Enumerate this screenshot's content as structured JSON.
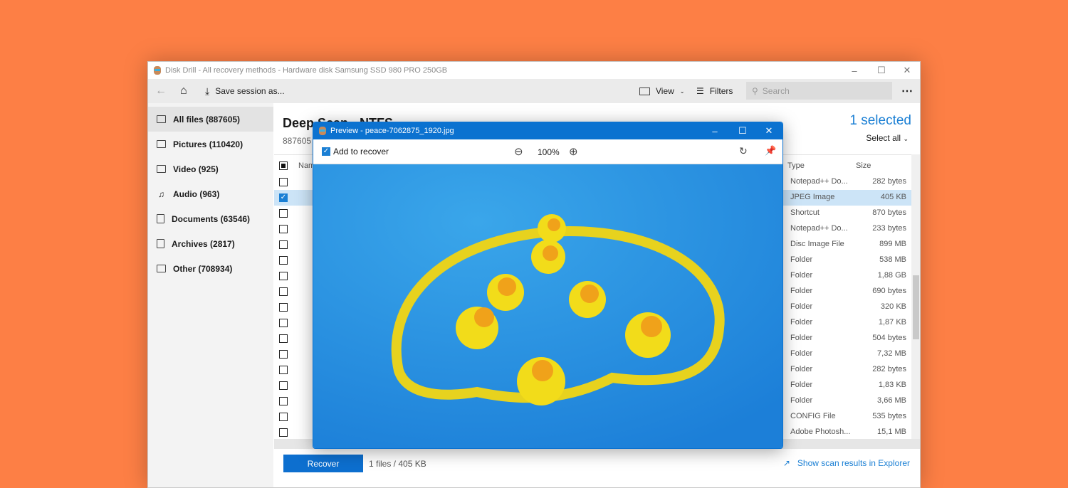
{
  "window": {
    "title": "Disk Drill - All recovery methods - Hardware disk Samsung SSD 980 PRO 250GB"
  },
  "toolbar": {
    "save_session": "Save session as...",
    "view": "View",
    "filters": "Filters",
    "search_placeholder": "Search"
  },
  "sidebar": {
    "items": [
      {
        "label": "All files (887605)"
      },
      {
        "label": "Pictures (110420)"
      },
      {
        "label": "Video (925)"
      },
      {
        "label": "Audio (963)"
      },
      {
        "label": "Documents (63546)"
      },
      {
        "label": "Archives (2817)"
      },
      {
        "label": "Other (708934)"
      }
    ]
  },
  "main": {
    "title": "Deep Scan - NTFS",
    "subtitle": "887605",
    "selected": "1 selected",
    "select_all": "Select all",
    "columns": {
      "name": "Name",
      "type": "Type",
      "size": "Size"
    },
    "rows": [
      {
        "type": "Notepad++ Do...",
        "size": "282 bytes",
        "checked": false
      },
      {
        "type": "JPEG Image",
        "size": "405 KB",
        "checked": true
      },
      {
        "type": "Shortcut",
        "size": "870 bytes",
        "checked": false
      },
      {
        "type": "Notepad++ Do...",
        "size": "233 bytes",
        "checked": false
      },
      {
        "type": "Disc Image File",
        "size": "899 MB",
        "checked": false
      },
      {
        "type": "Folder",
        "size": "538 MB",
        "checked": false
      },
      {
        "type": "Folder",
        "size": "1,88 GB",
        "checked": false
      },
      {
        "type": "Folder",
        "size": "690 bytes",
        "checked": false
      },
      {
        "type": "Folder",
        "size": "320 KB",
        "checked": false
      },
      {
        "type": "Folder",
        "size": "1,87 KB",
        "checked": false
      },
      {
        "type": "Folder",
        "size": "504 bytes",
        "checked": false
      },
      {
        "type": "Folder",
        "size": "7,32 MB",
        "checked": false
      },
      {
        "type": "Folder",
        "size": "282 bytes",
        "checked": false
      },
      {
        "type": "Folder",
        "size": "1,83 KB",
        "checked": false
      },
      {
        "type": "Folder",
        "size": "3,66 MB",
        "checked": false
      },
      {
        "type": "CONFIG File",
        "size": "535 bytes",
        "checked": false
      },
      {
        "type": "Adobe Photosh...",
        "size": "15,1 MB",
        "checked": false
      }
    ]
  },
  "footer": {
    "recover": "Recover",
    "summary": "1 files / 405 KB",
    "explorer_link": "Show scan results in Explorer"
  },
  "preview": {
    "title": "Preview - peace-7062875_1920.jpg",
    "add_to_recover": "Add to recover",
    "add_checked": true,
    "zoom": "100%"
  },
  "colors": {
    "accent": "#0b72d0",
    "background": "#fd7f45",
    "selected_row": "#cce4f7"
  }
}
